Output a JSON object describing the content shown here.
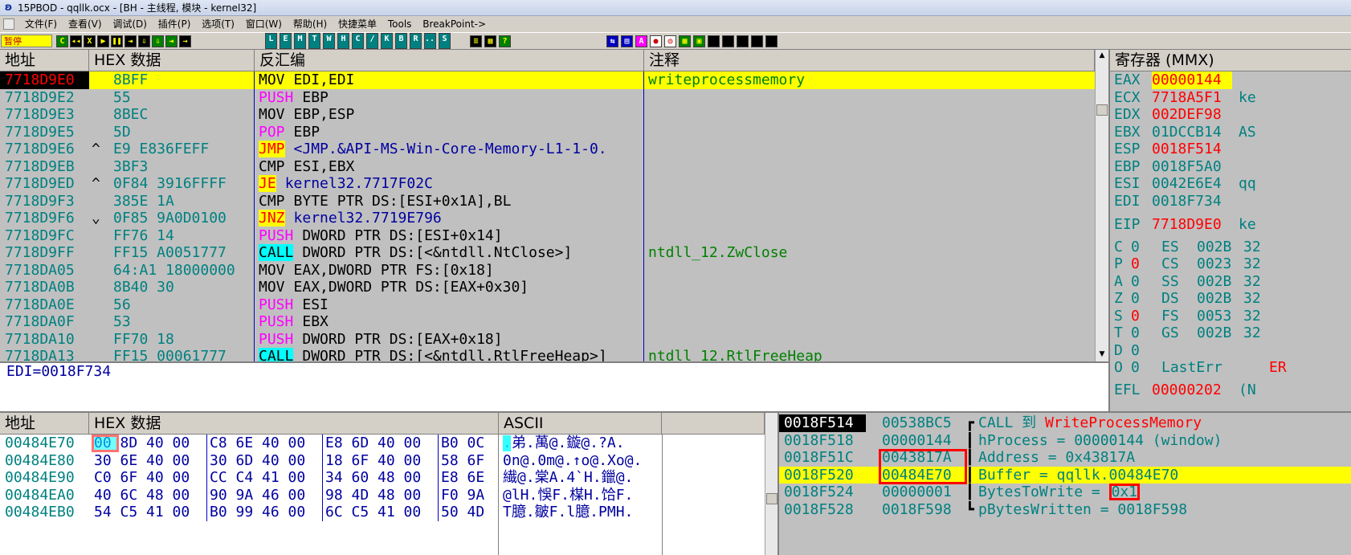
{
  "window": {
    "title": "15PBOD - qqllk.ocx - [BH - 主线程, 模块 - kernel32]",
    "icon_label": "ʚ"
  },
  "menu": [
    "文件(F)",
    "查看(V)",
    "调试(D)",
    "插件(P)",
    "选项(T)",
    "窗口(W)",
    "帮助(H)",
    "快捷菜单",
    "Tools",
    "BreakPoint->"
  ],
  "toolbar": {
    "status": "暂停",
    "group1": [
      "C",
      "◂◂",
      "X",
      "▶",
      "❚❚",
      "⇥",
      "⇩",
      "⇩",
      "⇥",
      "→"
    ],
    "group2": [
      "L",
      "E",
      "M",
      "T",
      "W",
      "H",
      "C",
      "/",
      "K",
      "B",
      "R",
      "...",
      "S"
    ],
    "group3": [
      "≡",
      "▦",
      "?"
    ],
    "group4": [
      "⇆",
      "▤",
      "A",
      "●",
      "◎",
      "▩",
      "▣",
      "",
      "",
      "",
      "",
      ""
    ]
  },
  "disasm": {
    "headers": {
      "addr": "地址",
      "hex": "HEX 数据",
      "dis": "反汇编",
      "comment": "注释"
    },
    "rows": [
      {
        "addr": "7718D9E0",
        "mk": "",
        "hex": "8BFF",
        "mn": "MOV",
        "op": "EDI,EDI",
        "comment": "writeprocessmemory"
      },
      {
        "addr": "7718D9E2",
        "mk": "",
        "hex": "55",
        "mn": "PUSH",
        "op": "EBP",
        "comment": ""
      },
      {
        "addr": "7718D9E3",
        "mk": "",
        "hex": "8BEC",
        "mn": "MOV",
        "op": "EBP,ESP",
        "comment": ""
      },
      {
        "addr": "7718D9E5",
        "mk": "",
        "hex": "5D",
        "mn": "POP",
        "op": "EBP",
        "comment": ""
      },
      {
        "addr": "7718D9E6",
        "mk": "^",
        "hex": "E9 E836FEFF",
        "mn": "JMP",
        "op": "<JMP.&API-MS-Win-Core-Memory-L1-1-0.",
        "comment": ""
      },
      {
        "addr": "7718D9EB",
        "mk": "",
        "hex": "3BF3",
        "mn": "CMP",
        "op": "ESI,EBX",
        "comment": ""
      },
      {
        "addr": "7718D9ED",
        "mk": "^",
        "hex": "0F84 3916FFFF",
        "mn": "JE",
        "op": "kernel32.7717F02C",
        "comment": ""
      },
      {
        "addr": "7718D9F3",
        "mk": "",
        "hex": "385E 1A",
        "mn": "CMP",
        "op": "BYTE PTR DS:[ESI+0x1A],BL",
        "comment": ""
      },
      {
        "addr": "7718D9F6",
        "mk": "⌄",
        "hex": "0F85 9A0D0100",
        "mn": "JNZ",
        "op": "kernel32.7719E796",
        "comment": ""
      },
      {
        "addr": "7718D9FC",
        "mk": "",
        "hex": "FF76 14",
        "mn": "PUSH",
        "op": "DWORD PTR DS:[ESI+0x14]",
        "comment": ""
      },
      {
        "addr": "7718D9FF",
        "mk": "",
        "hex": "FF15 A0051777",
        "mn": "CALL",
        "op": "DWORD PTR DS:[<&ntdll.NtClose>]",
        "comment": "ntdll_12.ZwClose"
      },
      {
        "addr": "7718DA05",
        "mk": "",
        "hex": "64:A1 18000000",
        "mn": "MOV",
        "op": "EAX,DWORD PTR FS:[0x18]",
        "comment": ""
      },
      {
        "addr": "7718DA0B",
        "mk": "",
        "hex": "8B40 30",
        "mn": "MOV",
        "op": "EAX,DWORD PTR DS:[EAX+0x30]",
        "comment": ""
      },
      {
        "addr": "7718DA0E",
        "mk": "",
        "hex": "56",
        "mn": "PUSH",
        "op": "ESI",
        "comment": ""
      },
      {
        "addr": "7718DA0F",
        "mk": "",
        "hex": "53",
        "mn": "PUSH",
        "op": "EBX",
        "comment": ""
      },
      {
        "addr": "7718DA10",
        "mk": "",
        "hex": "FF70 18",
        "mn": "PUSH",
        "op": "DWORD PTR DS:[EAX+0x18]",
        "comment": ""
      },
      {
        "addr": "7718DA13",
        "mk": "",
        "hex": "FF15 00061777",
        "mn": "CALL",
        "op": "DWORD PTR DS:[<&ntdll.RtlFreeHeap>]",
        "comment": "ntdll_12.RtlFreeHeap"
      }
    ],
    "info": "EDI=0018F734"
  },
  "registers": {
    "header": "寄存器 (MMX)",
    "gp": [
      {
        "name": "EAX",
        "val": "00000144",
        "tail": "",
        "changed": true
      },
      {
        "name": "ECX",
        "val": "7718A5F1",
        "tail": "ke",
        "changed": true
      },
      {
        "name": "EDX",
        "val": "002DEF98",
        "tail": "",
        "changed": true
      },
      {
        "name": "EBX",
        "val": "01DCCB14",
        "tail": "AS",
        "changed": false
      },
      {
        "name": "ESP",
        "val": "0018F514",
        "tail": "",
        "changed": true
      },
      {
        "name": "EBP",
        "val": "0018F5A0",
        "tail": "",
        "changed": false
      },
      {
        "name": "ESI",
        "val": "0042E6E4",
        "tail": "qq",
        "changed": false
      },
      {
        "name": "EDI",
        "val": "0018F734",
        "tail": "",
        "changed": false
      }
    ],
    "eip": {
      "name": "EIP",
      "val": "7718D9E0",
      "tail": "ke"
    },
    "flags": [
      {
        "f": "C",
        "v": "0",
        "seg": "ES",
        "sv": "002B",
        "bits": "32",
        "changed": false
      },
      {
        "f": "P",
        "v": "0",
        "seg": "CS",
        "sv": "0023",
        "bits": "32",
        "changed": true
      },
      {
        "f": "A",
        "v": "0",
        "seg": "SS",
        "sv": "002B",
        "bits": "32",
        "changed": false
      },
      {
        "f": "Z",
        "v": "0",
        "seg": "DS",
        "sv": "002B",
        "bits": "32",
        "changed": false
      },
      {
        "f": "S",
        "v": "0",
        "seg": "FS",
        "sv": "0053",
        "bits": "32",
        "changed": true
      },
      {
        "f": "T",
        "v": "0",
        "seg": "GS",
        "sv": "002B",
        "bits": "32",
        "changed": false
      },
      {
        "f": "D",
        "v": "0",
        "seg": "",
        "sv": "",
        "bits": "",
        "changed": false
      },
      {
        "f": "O",
        "v": "0",
        "seg": "LastErr",
        "sv": "ER",
        "bits": "",
        "changed": false
      }
    ],
    "efl": {
      "name": "EFL",
      "val": "00000202",
      "tail": "(N"
    }
  },
  "dump": {
    "headers": {
      "addr": "地址",
      "hex": "HEX 数据",
      "ascii": "ASCII"
    },
    "rows": [
      {
        "addr": "00484E70",
        "g": [
          "00 8D 40 00",
          "C8 6E 40 00",
          "E8 6D 40 00",
          "B0 0C"
        ],
        "ascii": ".弟.萬@.鏇@.?A."
      },
      {
        "addr": "00484E80",
        "g": [
          "30 6E 40 00",
          "30 6D 40 00",
          "18 6F 40 00",
          "58 6F"
        ],
        "ascii": "0n@.0m@.↑o@.Xo@."
      },
      {
        "addr": "00484E90",
        "g": [
          "C0 6F 40 00",
          "CC C4 41 00",
          "34 60 48 00",
          "E8 6E"
        ],
        "ascii": "繊@.棠A.4`H.鑞@."
      },
      {
        "addr": "00484EA0",
        "g": [
          "40 6C 48 00",
          "90 9A 46 00",
          "98 4D 48 00",
          "F0 9A"
        ],
        "ascii": "@lH.悞F.楳H.饸F."
      },
      {
        "addr": "00484EB0",
        "g": [
          "54 C5 41 00",
          "B0 99 46 00",
          "6C C5 41 00",
          "50 4D"
        ],
        "ascii": "T臆.皺F.l臆.PMH."
      }
    ]
  },
  "stack": {
    "rows": [
      {
        "addr": "0018F514",
        "val": "00538BC5",
        "br": "┏",
        "pre": "CALL 到 ",
        "red": "WriteProcessMemory",
        "post": "",
        "box": "",
        "cur": true,
        "hl": false
      },
      {
        "addr": "0018F518",
        "val": "00000144",
        "br": "┃",
        "pre": "hProcess = 00000144 (window)",
        "red": "",
        "post": "",
        "box": "",
        "cur": false,
        "hl": false
      },
      {
        "addr": "0018F51C",
        "val": "0043817A",
        "br": "┃",
        "pre": "Address = 0x43817A",
        "red": "",
        "post": "",
        "box": "",
        "cur": false,
        "hl": false
      },
      {
        "addr": "0018F520",
        "val": "00484E70",
        "br": "┃",
        "pre": "Buffer = qqllk.00484E70",
        "red": "",
        "post": "",
        "box": "",
        "cur": false,
        "hl": true
      },
      {
        "addr": "0018F524",
        "val": "00000001",
        "br": "┃",
        "pre": "BytesToWrite = ",
        "red": "",
        "post": "",
        "box": "0x1",
        "cur": false,
        "hl": false
      },
      {
        "addr": "0018F528",
        "val": "0018F598",
        "br": "┗",
        "pre": "pBytesWritten = 0018F598",
        "red": "",
        "post": "",
        "box": "",
        "cur": false,
        "hl": false
      }
    ]
  }
}
